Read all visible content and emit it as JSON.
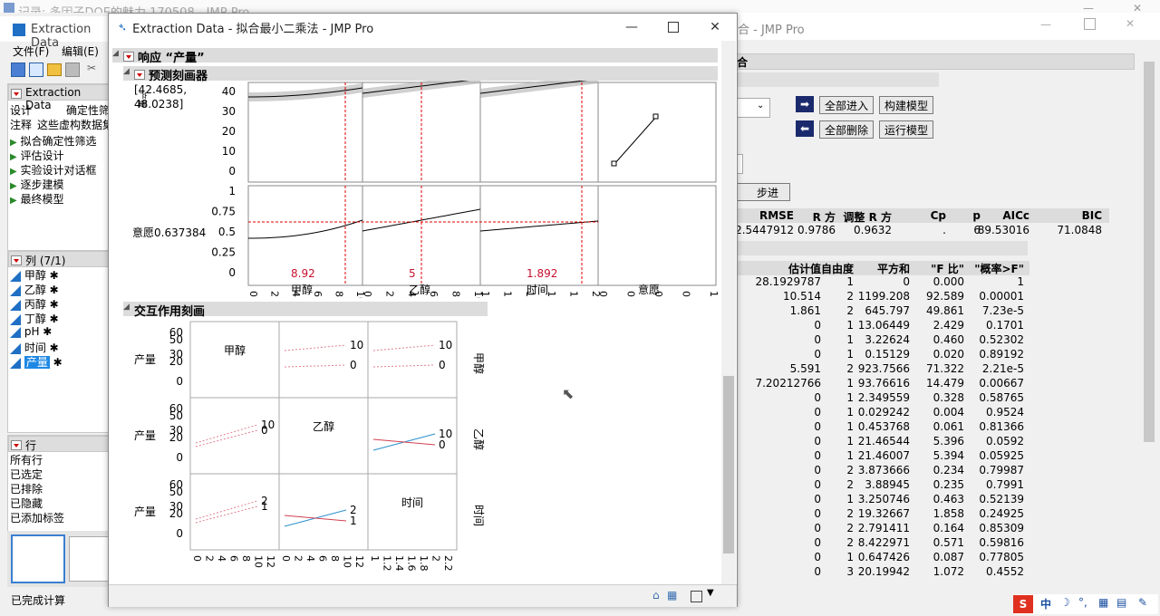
{
  "bg_window": {
    "title": "记录: 多因子DOE的魅力 170508 - JMP Pro"
  },
  "left_window": {
    "title": "Extraction Data",
    "menu": [
      "文件(F)",
      "编辑(E)"
    ],
    "panel_title": "Extraction Data",
    "design_label": "设计",
    "design_value": "确定性筛",
    "note_label": "注释",
    "note_value": "这些虚构数据集",
    "scripts": [
      "拟合确定性筛选",
      "评估设计",
      "实验设计对话框",
      "逐步建模",
      "最终模型"
    ],
    "columns_title": "列 (7/1)",
    "columns": [
      "甲醇",
      "乙醇",
      "丙醇",
      "丁醇",
      "pH",
      "时间",
      "产量"
    ],
    "rows_title": "行",
    "rows": [
      "所有行",
      "已选定",
      "已排除",
      "已隐藏",
      "已添加标签"
    ],
    "status": "已完成计算"
  },
  "right_window": {
    "title": "合 - JMP Pro",
    "section": "合",
    "buttons": {
      "enter_all": "全部进入",
      "build": "构建模型",
      "remove_all": "全部删除",
      "run": "运行模型",
      "step": "步进"
    },
    "stats_headers": [
      "RMSE",
      "R 方",
      "调整 R 方",
      "Cp",
      "p",
      "AICc",
      "BIC"
    ],
    "stats_values": [
      "2.5447912",
      "0.9786",
      "0.9632",
      ".",
      "6",
      "89.53016",
      "71.0848"
    ],
    "table_headers": [
      "估计值",
      "自由度",
      "平方和",
      "\"F 比\"",
      "\"概率>F\""
    ],
    "table_rows": [
      [
        "28.1929787",
        "1",
        "0",
        "0.000",
        "1"
      ],
      [
        "10.514",
        "2",
        "1199.208",
        "92.589",
        "0.00001"
      ],
      [
        "1.861",
        "2",
        "645.797",
        "49.861",
        "7.23e-5"
      ],
      [
        "0",
        "1",
        "13.06449",
        "2.429",
        "0.1701"
      ],
      [
        "0",
        "1",
        "3.22624",
        "0.460",
        "0.52302"
      ],
      [
        "0",
        "1",
        "0.15129",
        "0.020",
        "0.89192"
      ],
      [
        "5.591",
        "2",
        "923.7566",
        "71.322",
        "2.21e-5"
      ],
      [
        "7.20212766",
        "1",
        "93.76616",
        "14.479",
        "0.00667"
      ],
      [
        "0",
        "1",
        "2.349559",
        "0.328",
        "0.58765"
      ],
      [
        "0",
        "1",
        "0.029242",
        "0.004",
        "0.9524"
      ],
      [
        "0",
        "1",
        "0.453768",
        "0.061",
        "0.81366"
      ],
      [
        "0",
        "1",
        "21.46544",
        "5.396",
        "0.0592"
      ],
      [
        "0",
        "1",
        "21.46007",
        "5.394",
        "0.05925"
      ],
      [
        "0",
        "2",
        "3.873666",
        "0.234",
        "0.79987"
      ],
      [
        "0",
        "2",
        "3.88945",
        "0.235",
        "0.7991"
      ],
      [
        "0",
        "1",
        "3.250746",
        "0.463",
        "0.52139"
      ],
      [
        "0",
        "2",
        "19.32667",
        "1.858",
        "0.24925"
      ],
      [
        "0",
        "2",
        "2.791411",
        "0.164",
        "0.85309"
      ],
      [
        "0",
        "2",
        "8.422971",
        "0.571",
        "0.59816"
      ],
      [
        "0",
        "1",
        "0.647426",
        "0.087",
        "0.77805"
      ],
      [
        "0",
        "3",
        "20.19942",
        "1.072",
        "0.4552"
      ]
    ]
  },
  "main_window": {
    "title": "Extraction Data - 拟合最小二乘法 - JMP Pro",
    "response_header": "响应 “产量”",
    "profiler_header": "预测刻画器",
    "ci_line1": "[42.4685,",
    "ci_line2": "48.0238]",
    "ylabel_partial": "产量",
    "desir_label": "意愿0.637384",
    "profiler": {
      "y_ticks_top": [
        "40",
        "30",
        "20",
        "10",
        "0"
      ],
      "y_ticks_desir": [
        "1",
        "0.75",
        "0.5",
        "0.25",
        "0"
      ],
      "x1_ticks": [
        "0",
        "2",
        "4",
        "6",
        "8",
        "10"
      ],
      "x2_ticks": [
        "0",
        "2",
        "4",
        "6",
        "8",
        "10"
      ],
      "x3_ticks": [
        "1",
        "1.2",
        "1.4",
        "1.6",
        "1.8",
        "2"
      ],
      "x4_ticks": [
        "0",
        "0.25",
        "0.5",
        "0.75",
        "1"
      ],
      "factor_values": [
        "8.92",
        "5",
        "1.892"
      ],
      "factor_names": [
        "甲醇",
        "乙醇",
        "时间",
        "意愿"
      ]
    },
    "interaction_header": "交互作用刻画",
    "interaction": {
      "ylabel": "产量",
      "y_ticks": [
        "60",
        "50",
        "30",
        "20",
        "0"
      ],
      "diag": [
        "甲醇",
        "乙醇",
        "时间"
      ],
      "side": [
        "甲醇",
        "乙醇",
        "时间"
      ],
      "level_labels": {
        "r0c1": [
          "10",
          "0"
        ],
        "r0c2": [
          "10",
          "0"
        ],
        "r1c0": [
          "10",
          "0"
        ],
        "r1c2": [
          "10",
          "0"
        ],
        "r2c0": [
          "2",
          "1"
        ],
        "r2c1": [
          "2",
          "1"
        ]
      },
      "x_ticks_c0": [
        "0",
        "2",
        "4",
        "6",
        "8",
        "10",
        "12"
      ],
      "x_ticks_c1": [
        "0",
        "2",
        "4",
        "6",
        "8",
        "10",
        "12"
      ],
      "x_ticks_c2": [
        "1",
        "1.2",
        "1.4",
        "1.6",
        "1.8",
        "2",
        "2.2"
      ]
    }
  },
  "taskbar": {
    "ime": "中"
  },
  "colors": {
    "ci_band": "#b0b0b0",
    "crosshair": "#e00000",
    "factor_value": "#c8102e",
    "blue_line": "#2a8fd0",
    "red_line": "#d04050"
  }
}
